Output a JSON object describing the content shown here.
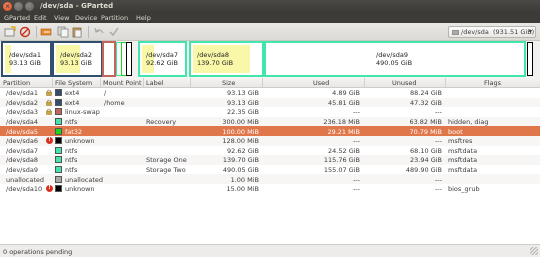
{
  "window": {
    "title": "/dev/sda - GParted"
  },
  "menu": [
    "GParted",
    "Edit",
    "View",
    "Device",
    "Partition",
    "Help"
  ],
  "device_selector": {
    "label": "/dev/sda",
    "size": "(931.51 GiB)"
  },
  "colors": {
    "ext4": "#314e6c",
    "linux-swap": "#c1665a",
    "ntfs": "#42e5ac",
    "fat32": "#18d918",
    "unknown": "#000000",
    "unallocated": "#a9a9a9",
    "selection": "#e0774a",
    "used_fill": "#f8f8a8"
  },
  "map": [
    {
      "name": "/dev/sda1",
      "size": "93.13 GiB"
    },
    {
      "name": "/dev/sda2",
      "size": "93.13 GiB"
    },
    {
      "name": "/dev/sda7",
      "size": "92.62 GiB"
    },
    {
      "name": "/dev/sda8",
      "size": "139.70 GiB"
    },
    {
      "name": "/dev/sda9",
      "size": "490.05 GiB"
    }
  ],
  "columns": [
    "Partition",
    "File System",
    "Mount Point",
    "Label",
    "Size",
    "Used",
    "Unused",
    "Flags"
  ],
  "rows": [
    {
      "partition": "/dev/sda1",
      "fs": "ext4",
      "mount": "/",
      "label": "",
      "size": "93.13 GiB",
      "used": "4.89 GiB",
      "unused": "88.24 GiB",
      "flags": ""
    },
    {
      "partition": "/dev/sda2",
      "fs": "ext4",
      "mount": "/home",
      "label": "",
      "size": "93.13 GiB",
      "used": "45.81 GiB",
      "unused": "47.32 GiB",
      "flags": ""
    },
    {
      "partition": "/dev/sda3",
      "fs": "linux-swap",
      "mount": "",
      "label": "",
      "size": "22.35 GiB",
      "used": "---",
      "unused": "---",
      "flags": ""
    },
    {
      "partition": "/dev/sda4",
      "fs": "ntfs",
      "mount": "",
      "label": "Recovery",
      "size": "300.00 MiB",
      "used": "236.18 MiB",
      "unused": "63.82 MiB",
      "flags": "hidden, diag"
    },
    {
      "partition": "/dev/sda5",
      "fs": "fat32",
      "mount": "",
      "label": "",
      "size": "100.00 MiB",
      "used": "29.21 MiB",
      "unused": "70.79 MiB",
      "flags": "boot"
    },
    {
      "partition": "/dev/sda6",
      "fs": "unknown",
      "mount": "",
      "label": "",
      "size": "128.00 MiB",
      "used": "---",
      "unused": "---",
      "flags": "msftres"
    },
    {
      "partition": "/dev/sda7",
      "fs": "ntfs",
      "mount": "",
      "label": "",
      "size": "92.62 GiB",
      "used": "24.52 GiB",
      "unused": "68.10 GiB",
      "flags": "msftdata"
    },
    {
      "partition": "/dev/sda8",
      "fs": "ntfs",
      "mount": "",
      "label": "Storage One",
      "size": "139.70 GiB",
      "used": "115.76 GiB",
      "unused": "23.94 GiB",
      "flags": "msftdata"
    },
    {
      "partition": "/dev/sda9",
      "fs": "ntfs",
      "mount": "",
      "label": "Storage Two",
      "size": "490.05 GiB",
      "used": "155.07 GiB",
      "unused": "489.90 GiB",
      "flags": "msftdata"
    },
    {
      "partition": "unallocated",
      "fs": "unallocated",
      "mount": "",
      "label": "",
      "size": "1.00 MiB",
      "used": "---",
      "unused": "---",
      "flags": ""
    },
    {
      "partition": "/dev/sda10",
      "fs": "unknown",
      "mount": "",
      "label": "",
      "size": "15.00 MiB",
      "used": "---",
      "unused": "---",
      "flags": "bios_grub"
    }
  ],
  "status": {
    "text": "0 operations pending"
  }
}
